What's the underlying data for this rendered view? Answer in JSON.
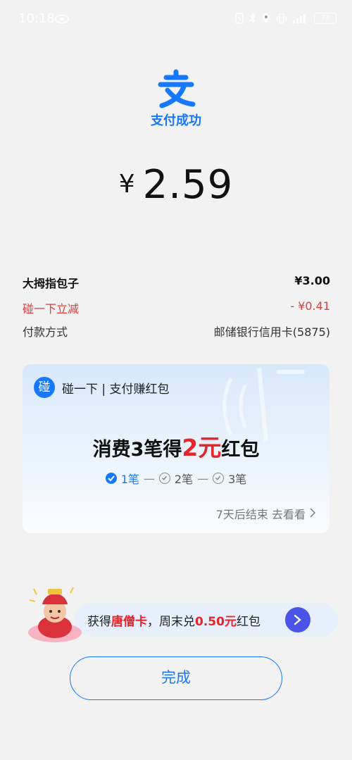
{
  "status_bar": {
    "time": "10:18",
    "battery": "73"
  },
  "header": {
    "success_label": "支付成功"
  },
  "payment": {
    "currency": "¥",
    "amount": "2.59"
  },
  "details": {
    "merchant_label": "大拇指包子",
    "merchant_amount": "¥3.00",
    "discount_label": "碰一下立减",
    "discount_amount": "- ¥0.41",
    "method_label": "付款方式",
    "method_value": "邮储银行信用卡(5875)"
  },
  "promo": {
    "badge": "碰",
    "title": "碰一下 | 支付赚红包",
    "headline_prefix": "消费3笔得",
    "headline_amount": "2元",
    "headline_suffix": "红包",
    "steps": [
      {
        "label": "1笔",
        "done": true
      },
      {
        "label": "2笔",
        "done": false
      },
      {
        "label": "3笔",
        "done": false
      }
    ],
    "step_separator": "—",
    "footer": "7天后结束 去看看"
  },
  "banner": {
    "prefix": "获得",
    "highlight_card": "唐僧卡",
    "middle": "，周末兑",
    "highlight_amount": "0.50元",
    "suffix": "红包"
  },
  "actions": {
    "done_label": "完成"
  },
  "colors": {
    "accent": "#1677ff",
    "red": "#e8242b",
    "background": "#f2f2f2"
  }
}
